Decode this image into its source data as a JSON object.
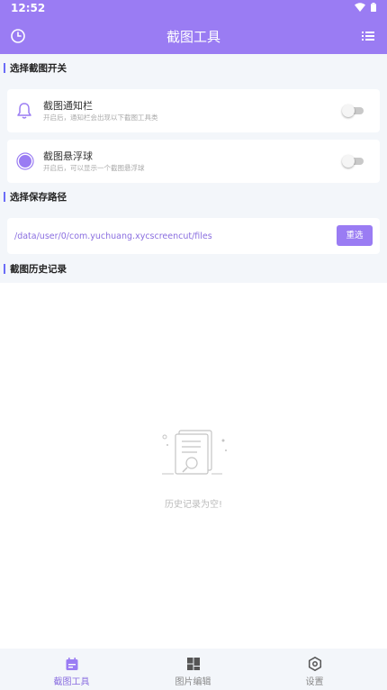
{
  "status_bar": {
    "time": "12:52"
  },
  "app_bar": {
    "title": "截图工具"
  },
  "sections": {
    "switch_title": "选择截图开关",
    "path_title": "选择保存路径",
    "history_title": "截图历史记录"
  },
  "cards": {
    "notification": {
      "title": "截图通知栏",
      "subtitle": "开启后，通知栏会出现以下截图工具类",
      "enabled": false
    },
    "floating_ball": {
      "title": "截图悬浮球",
      "subtitle": "开启后，可以显示一个截图悬浮球",
      "enabled": false
    }
  },
  "save_path": {
    "path": "/data/user/0/com.yuchuang.xycscreencut/files",
    "button_label": "重选"
  },
  "history": {
    "empty_text": "历史记录为空!"
  },
  "bottom_nav": {
    "items": [
      {
        "label": "截图工具",
        "icon": "calendar-icon",
        "active": true
      },
      {
        "label": "图片编辑",
        "icon": "grid-icon",
        "active": false
      },
      {
        "label": "设置",
        "icon": "hexagon-settings-icon",
        "active": false
      }
    ]
  },
  "colors": {
    "accent": "#9a7cf3",
    "background": "#f3f6fa",
    "section_bar": "#6b6cf7"
  }
}
